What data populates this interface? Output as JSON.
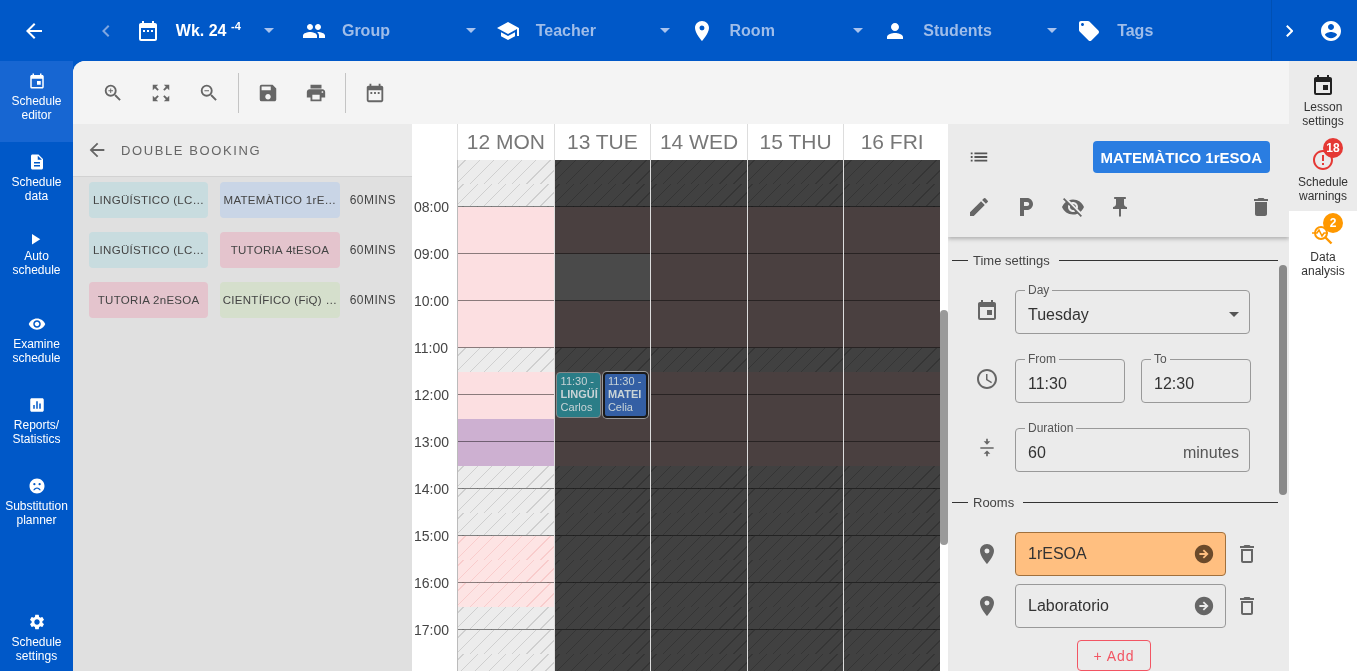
{
  "topbar": {
    "prev": {
      "disabled": true
    },
    "next": {
      "disabled": false
    },
    "filters": [
      {
        "kind": "week",
        "value": "Wk. 24 $^{-4}$",
        "caret": true
      },
      {
        "kind": "group",
        "placeholder": "Group",
        "caret": true
      },
      {
        "kind": "teacher",
        "placeholder": "Teacher",
        "caret": true
      },
      {
        "kind": "room",
        "placeholder": "Room",
        "caret": true
      },
      {
        "kind": "students",
        "placeholder": "Students",
        "caret": true
      },
      {
        "kind": "tags",
        "placeholder": "Tags",
        "caret": false
      }
    ]
  },
  "sidebar": {
    "items": [
      {
        "kind": "editor",
        "label": "Schedule editor",
        "selected": true
      },
      {
        "kind": "data",
        "label": "Schedule data",
        "selected": false
      },
      {
        "kind": "auto",
        "label": "Auto schedule",
        "selected": false
      },
      {
        "kind": "examine",
        "label": "Examine schedule",
        "selected": false
      },
      {
        "kind": "reports",
        "label": "Reports/ Statistics",
        "selected": false
      },
      {
        "kind": "substitution",
        "label": "Substitution planner",
        "selected": false
      },
      {
        "kind": "settings",
        "label": "Schedule settings",
        "selected": false
      }
    ]
  },
  "double_booking": {
    "title": "DOUBLE BOOKING",
    "rows": [
      {
        "lessons": [
          {
            "label": "LINGÜÍSTICO (LC…",
            "color": "#c8dcdf"
          },
          {
            "label": "MATEMÀTICO 1rE…",
            "color": "#c9d5e6"
          }
        ],
        "duration": "60MINS"
      },
      {
        "lessons": [
          {
            "label": "LINGÜÍSTICO (LC…",
            "color": "#c8dcdf"
          },
          {
            "label": "TUTORIA 4tESOA",
            "color": "#e4c4cd"
          }
        ],
        "duration": "60MINS"
      },
      {
        "lessons": [
          {
            "label": "TUTORIA 2nESOA",
            "color": "#e4c4cd"
          },
          {
            "label": "CIENTÍFICO (FiQ) …",
            "color": "#d5dfcc"
          }
        ],
        "duration": "60MINS"
      }
    ]
  },
  "calendar": {
    "times": [
      "08:00",
      "09:00",
      "10:00",
      "11:00",
      "12:00",
      "13:00",
      "14:00",
      "15:00",
      "16:00",
      "17:00"
    ],
    "days": [
      {
        "label": "12 MON",
        "slots": [
          {
            "kind": "unavailable"
          },
          {
            "kind": "unavailable"
          },
          {
            "kind": "free"
          },
          {
            "kind": "free"
          },
          {
            "kind": "free"
          },
          {
            "kind": "free"
          },
          {
            "kind": "free"
          },
          {
            "kind": "free"
          },
          {
            "kind": "unavailable"
          },
          {
            "kind": "free"
          },
          {
            "kind": "free"
          },
          {
            "kind": "lesson"
          },
          {
            "kind": "lesson"
          },
          {
            "kind": "unavailable"
          },
          {
            "kind": "unavailable"
          },
          {
            "kind": "unavailable"
          },
          {
            "kind": "unavailablefree"
          },
          {
            "kind": "unavailablefree"
          },
          {
            "kind": "unavailablefree"
          },
          {
            "kind": "unavailable"
          },
          {
            "kind": "unavailable"
          },
          {
            "kind": "unavailable"
          }
        ]
      },
      {
        "label": "13 TUE",
        "slots": [
          {
            "kind": "dimmedunavailable"
          },
          {
            "kind": "dimmedunavailable"
          },
          {
            "kind": "dimmed"
          },
          {
            "kind": "dimmed"
          },
          {
            "kind": "dimmedfree"
          },
          {
            "kind": "dimmedfree"
          },
          {
            "kind": "dimmed"
          },
          {
            "kind": "dimmed"
          },
          {
            "kind": "dimmedunavailable"
          },
          {
            "kind": "dimmed",
            "events": [
              {
                "time": "11:30 -",
                "title": "LINGÜÍ",
                "teacher": "Carlos",
                "color": "#2b7d87",
                "selected": false
              },
              {
                "time": "11:30 -",
                "title": "MATEI",
                "teacher": "Celia",
                "color": "#345fa4",
                "selected": true
              }
            ]
          },
          {
            "kind": "dimmed"
          },
          {
            "kind": "dimmed"
          },
          {
            "kind": "dimmedunavailable"
          },
          {
            "kind": "dimmedunavailable"
          },
          {
            "kind": "dimmedunavailable"
          },
          {
            "kind": "dimmedunavailable"
          },
          {
            "kind": "dimmedunavailable"
          },
          {
            "kind": "dimmedunavailable"
          },
          {
            "kind": "dimmedunavailable"
          },
          {
            "kind": "dimmedunavailable"
          },
          {
            "kind": "dimmedunavailable"
          }
        ]
      },
      {
        "label": "14 WED",
        "slots": [
          {
            "kind": "dimmedunavailable"
          },
          {
            "kind": "dimmedunavailable"
          },
          {
            "kind": "dimmed"
          },
          {
            "kind": "dimmed"
          },
          {
            "kind": "dimmed"
          },
          {
            "kind": "dimmed"
          },
          {
            "kind": "dimmed"
          },
          {
            "kind": "dimmed"
          },
          {
            "kind": "dimmedunavailable"
          },
          {
            "kind": "dimmed"
          },
          {
            "kind": "dimmed"
          },
          {
            "kind": "dimmed"
          },
          {
            "kind": "dimmed"
          },
          {
            "kind": "dimmedunavailable"
          },
          {
            "kind": "dimmedunavailable"
          },
          {
            "kind": "dimmedunavailable"
          },
          {
            "kind": "dimmedunavailable"
          },
          {
            "kind": "dimmedunavailable"
          },
          {
            "kind": "dimmedunavailable"
          },
          {
            "kind": "dimmedunavailable"
          },
          {
            "kind": "dimmedunavailable"
          },
          {
            "kind": "dimmedunavailable"
          }
        ]
      },
      {
        "label": "15 THU",
        "slots": [
          {
            "kind": "dimmedunavailable"
          },
          {
            "kind": "dimmedunavailable"
          },
          {
            "kind": "dimmed"
          },
          {
            "kind": "dimmed"
          },
          {
            "kind": "dimmed"
          },
          {
            "kind": "dimmed"
          },
          {
            "kind": "dimmed"
          },
          {
            "kind": "dimmed"
          },
          {
            "kind": "dimmedunavailable"
          },
          {
            "kind": "dimmed"
          },
          {
            "kind": "dimmed"
          },
          {
            "kind": "dimmed"
          },
          {
            "kind": "dimmed"
          },
          {
            "kind": "dimmedunavailable"
          },
          {
            "kind": "dimmedunavailable"
          },
          {
            "kind": "dimmedunavailable"
          },
          {
            "kind": "dimmedunavailable"
          },
          {
            "kind": "dimmedunavailable"
          },
          {
            "kind": "dimmedunavailable"
          },
          {
            "kind": "dimmedunavailable"
          },
          {
            "kind": "dimmedunavailable"
          },
          {
            "kind": "dimmedunavailable"
          }
        ]
      },
      {
        "label": "16 FRI",
        "slots": [
          {
            "kind": "dimmedunavailable"
          },
          {
            "kind": "dimmedunavailable"
          },
          {
            "kind": "dimmed"
          },
          {
            "kind": "dimmed"
          },
          {
            "kind": "dimmed"
          },
          {
            "kind": "dimmed"
          },
          {
            "kind": "dimmed"
          },
          {
            "kind": "dimmed"
          },
          {
            "kind": "dimmedunavailable"
          },
          {
            "kind": "dimmed"
          },
          {
            "kind": "dimmed"
          },
          {
            "kind": "dimmed"
          },
          {
            "kind": "dimmed"
          },
          {
            "kind": "dimmedunavailable"
          },
          {
            "kind": "dimmedunavailable"
          },
          {
            "kind": "dimmedunavailable"
          },
          {
            "kind": "dimmedunavailable"
          },
          {
            "kind": "dimmedunavailable"
          },
          {
            "kind": "dimmedunavailable"
          },
          {
            "kind": "dimmedunavailable"
          },
          {
            "kind": "dimmedunavailable"
          },
          {
            "kind": "dimmedunavailable"
          }
        ]
      }
    ]
  },
  "details": {
    "title": "MATEMÀTICO 1rESOA",
    "time_settings": {
      "legend": "Time settings",
      "day": {
        "label": "Day",
        "value": "Tuesday"
      },
      "from": {
        "label": "From",
        "value": "11:30"
      },
      "to": {
        "label": "To",
        "value": "12:30"
      },
      "duration": {
        "label": "Duration",
        "value": "60",
        "unit": "minutes"
      }
    },
    "rooms": {
      "legend": "Rooms",
      "items": [
        {
          "name": "1rESOA",
          "highlighted": true
        },
        {
          "name": "Laboratorio",
          "highlighted": false
        }
      ],
      "add_button": "+ Add"
    }
  },
  "rail": [
    {
      "kind": "lesson",
      "label": "Lesson settings",
      "selected": false
    },
    {
      "kind": "warnings",
      "label": "Schedule warnings",
      "badge": "18",
      "color": "#e53935",
      "selected": false
    },
    {
      "kind": "analysis",
      "label": "Data analysis",
      "badge": "2",
      "color": "#ff9800",
      "selected": true
    }
  ]
}
